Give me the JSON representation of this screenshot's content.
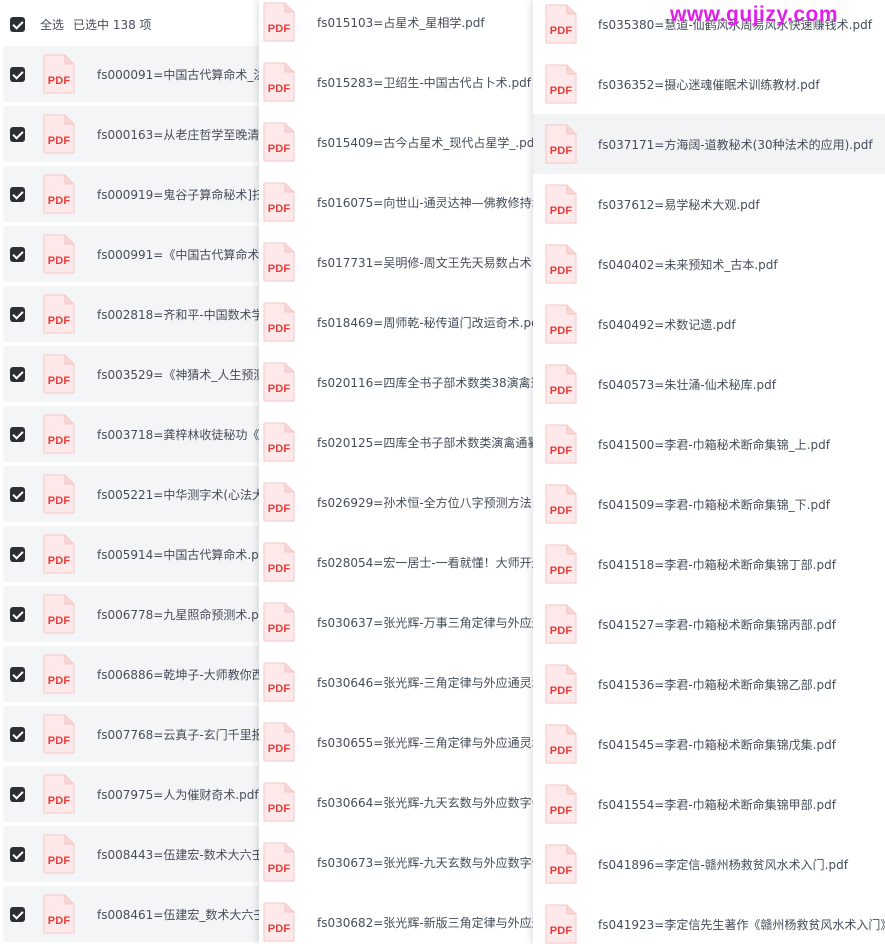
{
  "header": {
    "select_all": "全选",
    "selected_count": "已选中 138 项"
  },
  "pdf_icon_label": "PDF",
  "watermark": "www.gujizy.com",
  "panel1": [
    "fs000091=中国古代算命术_洪",
    "fs000163=从老庄哲学至晚清方",
    "fs000919=鬼谷子算命秘术]扫",
    "fs000991=《中国古代算命术》",
    "fs002818=齐和平-中国数术学",
    "fs003529=《神猜术_人生预测",
    "fs003718=龚梓林收徒秘功《秘",
    "fs005221=中华测字术(心法大",
    "fs005914=中国古代算命术.pdf",
    "fs006778=九星照命预测术.pdf",
    "fs006886=乾坤子-大师教你西",
    "fs007768=云真子-玄门千里报",
    "fs007975=人为催财奇术.pdf",
    "fs008443=伍建宏-数术大六壬",
    "fs008461=伍建宏_数术大六壬"
  ],
  "panel2": [
    "fs015103=占星术_星相学.pdf",
    "fs015283=卫绍生-中国古代占卜术.pdf",
    "fs015409=古今占星术_现代占星学_.pdf",
    "fs016075=向世山-通灵达神—佛教修持术",
    "fs017731=吴明修-周文王先天易数占术.p",
    "fs018469=周师乾-秘传道门改运奇术.pdf",
    "fs020116=四库全书子部术数类38演禽通",
    "fs020125=四库全书子部术数类演禽通纂",
    "fs026929=孙术恒-全方位八字预测方法.p",
    "fs028054=宏一居士-一看就懂！大师开运",
    "fs030637=张光辉-万事三角定律与外应通",
    "fs030646=张光辉-三角定律与外应通灵术",
    "fs030655=张光辉-三角定律与外应通灵术",
    "fs030664=张光辉-九天玄数与外应数字化",
    "fs030673=张光辉-九天玄数与外应数字化",
    "fs030682=张光辉-新版三角定律与外应通"
  ],
  "panel3": [
    "fs035380=慧道-仙鹤风水周易风水快速赚钱术.pdf",
    "fs036352=摄心迷魂催眠术训练教材.pdf",
    "fs037171=方海阔-道教秘术(30种法术的应用).pdf",
    "fs037612=易学秘术大观.pdf",
    "fs040402=未来预知术_古本.pdf",
    "fs040492=术数记遗.pdf",
    "fs040573=朱壮涌-仙术秘库.pdf",
    "fs041500=李君-巾箱秘术断命集锦_上.pdf",
    "fs041509=李君-巾箱秘术断命集锦_下.pdf",
    "fs041518=李君-巾箱秘术断命集锦丁部.pdf",
    "fs041527=李君-巾箱秘术断命集锦丙部.pdf",
    "fs041536=李君-巾箱秘术断命集锦乙部.pdf",
    "fs041545=李君-巾箱秘术断命集锦戊集.pdf",
    "fs041554=李君-巾箱秘术断命集锦甲部.pdf",
    "fs041896=李定信-赣州杨救贫风水术入门.pdf",
    "fs041923=李定信先生著作《赣州杨救贫风水术入门》"
  ],
  "highlighted_row_panel3": 2,
  "colors": {
    "pdf_red": "#e83b3b",
    "pdf_bg": "#fde9e9",
    "checkbox": "#2c2f33",
    "row_bg": "#f4f5f7",
    "watermark": "#e020e8"
  }
}
